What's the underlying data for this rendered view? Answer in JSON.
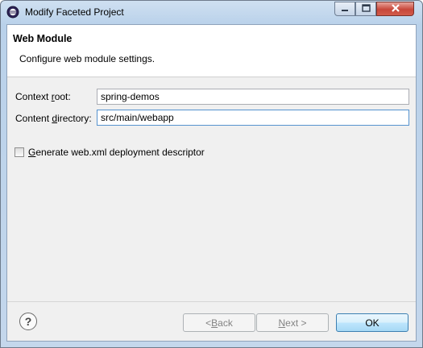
{
  "window": {
    "title": "Modify Faceted Project"
  },
  "banner": {
    "title": "Web Module",
    "description": "Configure web module settings."
  },
  "form": {
    "context_root": {
      "label_pre": "Context ",
      "label_mnemonic": "r",
      "label_post": "oot:",
      "value": "spring-demos"
    },
    "content_directory": {
      "label_pre": "Content ",
      "label_mnemonic": "d",
      "label_post": "irectory:",
      "value": "src/main/webapp"
    },
    "generate_webxml": {
      "label_mnemonic": "G",
      "label_post": "enerate web.xml deployment descriptor",
      "checked": false
    }
  },
  "buttons": {
    "help_symbol": "?",
    "back": {
      "prefix": "< ",
      "mnemonic": "B",
      "rest": "ack"
    },
    "next": {
      "mnemonic": "N",
      "rest": "ext >"
    },
    "ok": "OK"
  },
  "colors": {
    "title_bar": "#b9d1ea",
    "close_button": "#c7473a",
    "default_button": "#bee6fd"
  }
}
